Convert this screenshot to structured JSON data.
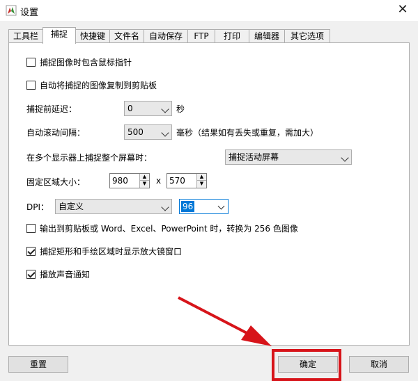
{
  "window": {
    "title": "设置"
  },
  "tabs": [
    "工具栏",
    "捕捉",
    "快捷键",
    "文件名",
    "自动保存",
    "FTP",
    "打印",
    "编辑器",
    "其它选项"
  ],
  "options": {
    "include_cursor": {
      "label": "捕捉图像时包含鼠标指针",
      "checked": false
    },
    "auto_copy": {
      "label": "自动将捕捉的图像复制到剪贴板",
      "checked": false
    },
    "delay": {
      "label": "捕捉前延迟：",
      "value": "0",
      "unit": "秒"
    },
    "scroll_interval": {
      "label": "自动滚动间隔：",
      "value": "500",
      "unit": "毫秒（结果如有丢失或重复，需加大）"
    },
    "multi_monitor": {
      "label": "在多个显示器上捕捉整个屏幕时：",
      "value": "捕捉活动屏幕"
    },
    "fixed_region": {
      "label": "固定区域大小：",
      "width": "980",
      "separator": "x",
      "height": "570"
    },
    "dpi": {
      "label": "DPI：",
      "mode": "自定义",
      "value": "96"
    },
    "clipboard_256": {
      "label": "输出到剪贴板或 Word、Excel、PowerPoint 时，转换为 256 色图像",
      "checked": false
    },
    "magnifier": {
      "label": "捕捉矩形和手绘区域时显示放大镜窗口",
      "checked": true
    },
    "sound": {
      "label": "播放声音通知",
      "checked": true
    }
  },
  "buttons": {
    "reset": "重置",
    "ok": "确定",
    "cancel": "取消"
  },
  "colors": {
    "annotation": "#d7141a",
    "selection": "#0078d7"
  }
}
